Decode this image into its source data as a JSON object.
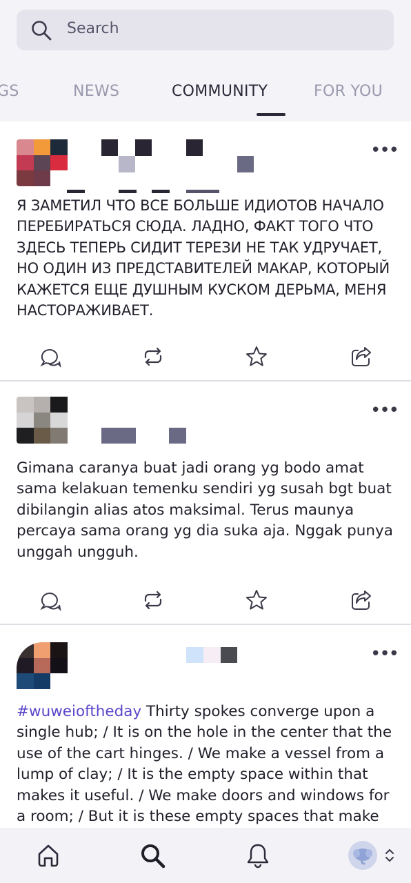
{
  "search": {
    "placeholder": "Search",
    "icon": "search-icon"
  },
  "tabs": [
    {
      "label": "GS",
      "active": false
    },
    {
      "label": "NEWS",
      "active": false
    },
    {
      "label": "COMMUNITY",
      "active": true
    },
    {
      "label": "FOR YOU",
      "active": false
    }
  ],
  "posts": [
    {
      "text": "Я ЗАМЕТИЛ ЧТО ВСЕ БОЛЬШЕ ИДИОТОВ НАЧАЛО ПЕРЕБИРАТЬСЯ СЮДА. ЛАДНО, ФАКТ ТОГО ЧТО ЗДЕСЬ ТЕПЕРЬ СИДИТ ТЕРЕЗИ НЕ ТАК УДРУЧАЕТ, НО ОДИН ИЗ ПРЕДСТАВИТЕЛЕЙ МАКАР, КОТОРЫЙ КАЖЕТСЯ ЕЩЕ ДУШНЫМ КУСКОМ ДЕРЬМА, МЕНЯ НАСТОРАЖИВАЕТ."
    },
    {
      "text": "Gimana caranya buat jadi orang yg bodo amat sama kelakuan temenku sendiri yg susah bgt buat dibilangin alias atos maksimal. Terus maunya percaya sama orang yg dia suka aja. Nggak punya unggah ungguh."
    },
    {
      "hashtag": "#wuweioftheday",
      "text": " Thirty spokes converge upon a single hub; / It is on the hole in the center that the use of the cart hinges. / We make a vessel from a lump of clay; / It is the empty space within that makes it useful. / We make doors and windows for a room; / But it is these empty spaces that make"
    }
  ],
  "actions": [
    "reply-icon",
    "repost-icon",
    "favorite-icon",
    "share-icon"
  ],
  "more_label": "•••",
  "bottom_nav": [
    "home-icon",
    "search-icon",
    "notifications-icon",
    "account-avatar"
  ],
  "colors": {
    "accent": "#5b45c9",
    "tab_active": "#2a2938",
    "tab_inactive": "#9a99ad",
    "background": "#f4f3f8"
  }
}
